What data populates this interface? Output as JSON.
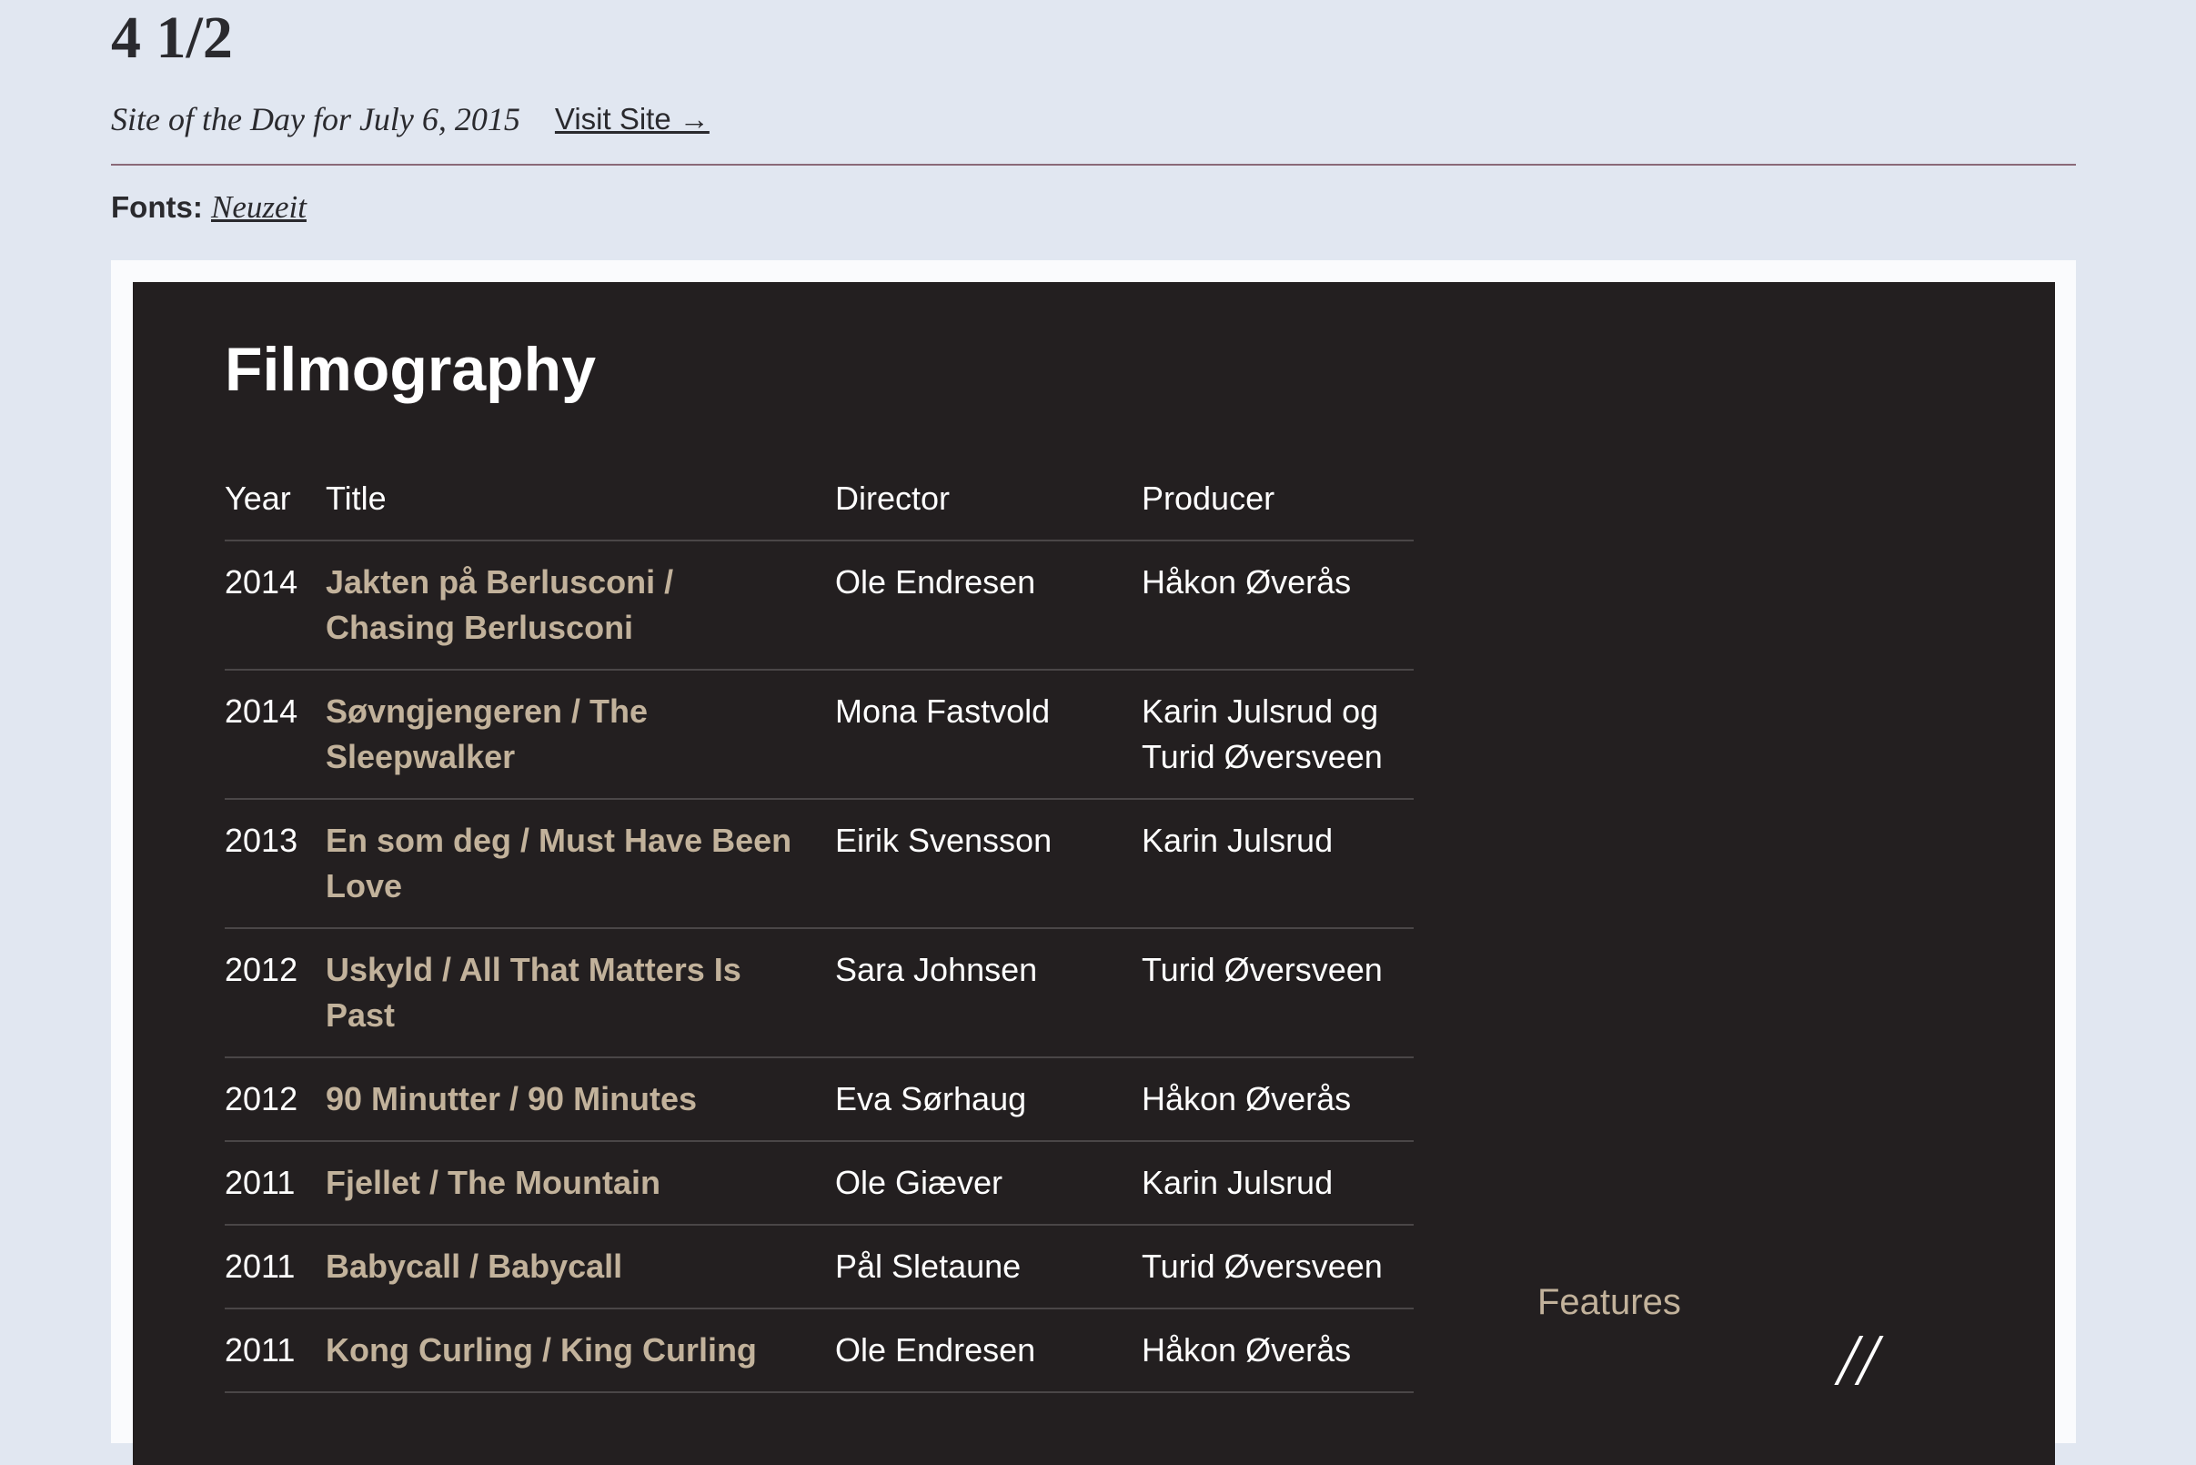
{
  "header": {
    "title": "4 1/2",
    "site_of_day": "Site of the Day for July 6, 2015",
    "visit_label": "Visit Site →",
    "fonts_label": "Fonts:",
    "font_name": "Neuzeit"
  },
  "colors": {
    "background": "#e1e7f1",
    "panel": "#231f20",
    "accent": "#c2b29b",
    "divider": "#8a6a78"
  },
  "preview": {
    "heading": "Filmography",
    "columns": [
      "Year",
      "Title",
      "Director",
      "Producer"
    ],
    "rows": [
      {
        "year": "2014",
        "title": "Jakten på Berlusconi / Chasing Berlusconi",
        "director": "Ole Endresen",
        "producer": "Håkon Øverås"
      },
      {
        "year": "2014",
        "title": "Søvngjengeren / The Sleepwalker",
        "director": "Mona Fastvold",
        "producer": "Karin Julsrud og Turid Øversveen"
      },
      {
        "year": "2013",
        "title": "En som deg / Must Have Been Love",
        "director": "Eirik Svensson",
        "producer": "Karin Julsrud"
      },
      {
        "year": "2012",
        "title": "Uskyld / All That Matters Is Past",
        "director": "Sara Johnsen",
        "producer": "Turid Øversveen"
      },
      {
        "year": "2012",
        "title": "90 Minutter / 90 Minutes",
        "director": "Eva Sørhaug",
        "producer": "Håkon Øverås"
      },
      {
        "year": "2011",
        "title": "Fjellet / The Mountain",
        "director": "Ole Giæver",
        "producer": "Karin Julsrud"
      },
      {
        "year": "2011",
        "title": "Babycall / Babycall",
        "director": "Pål Sletaune",
        "producer": "Turid Øversveen"
      },
      {
        "year": "2011",
        "title": "Kong Curling / King Curling",
        "director": "Ole Endresen",
        "producer": "Håkon Øverås"
      }
    ],
    "features_label": "Features"
  }
}
